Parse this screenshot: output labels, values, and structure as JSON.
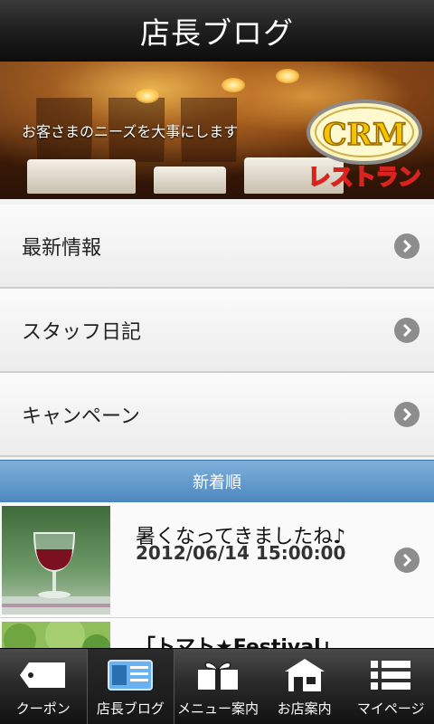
{
  "header": {
    "title": "店長ブログ"
  },
  "banner": {
    "tagline": "お客さまのニーズを大事にします",
    "logo_top": "CRM",
    "logo_bottom": "レストラン"
  },
  "menu": [
    {
      "label": "最新情報",
      "icon": "chevron-right-icon"
    },
    {
      "label": "スタッフ日記",
      "icon": "chevron-right-icon"
    },
    {
      "label": "キャンペーン",
      "icon": "chevron-right-icon"
    }
  ],
  "section": {
    "label": "新着順"
  },
  "posts": [
    {
      "title": "暑くなってきましたね♪",
      "date": "2012/06/14 15:00:00",
      "thumb_icon": "wine-glass-photo"
    },
    {
      "title": "「トマト★Festival」",
      "date": "",
      "thumb_icon": "tomato-plant-photo"
    }
  ],
  "tabs": [
    {
      "label": "クーポン",
      "icon": "coupon-icon",
      "active": false
    },
    {
      "label": "店長ブログ",
      "icon": "blog-icon",
      "active": true
    },
    {
      "label": "メニュー案内",
      "icon": "gift-menu-icon",
      "active": false
    },
    {
      "label": "お店案内",
      "icon": "shop-icon",
      "active": false
    },
    {
      "label": "マイページ",
      "icon": "list-icon",
      "active": false
    }
  ],
  "colors": {
    "section_blue": "#5f97c9",
    "chevron_gray": "#8d8d8d",
    "logo_yellow": "#f5c400",
    "logo_red": "#d9231f"
  }
}
